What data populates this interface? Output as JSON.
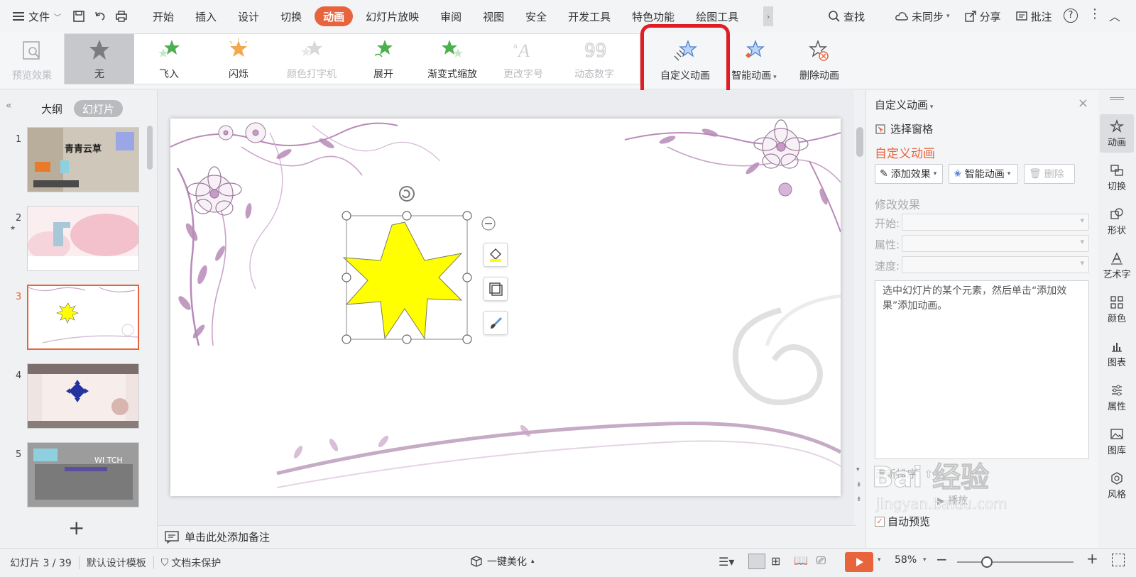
{
  "menubar": {
    "file_label": "文件",
    "tabs": [
      "开始",
      "插入",
      "设计",
      "切换",
      "动画",
      "幻灯片放映",
      "审阅",
      "视图",
      "安全",
      "开发工具",
      "特色功能",
      "绘图工具"
    ],
    "active_tab": "动画",
    "search_label": "查找",
    "sync_label": "未同步",
    "share_label": "分享",
    "comment_label": "批注"
  },
  "ribbon": {
    "preview_label": "预览效果",
    "gallery": [
      {
        "label": "无",
        "icon": "star-gray-icon",
        "selected": true,
        "disabled": false
      },
      {
        "label": "飞入",
        "icon": "star-fly-icon",
        "selected": false,
        "disabled": false
      },
      {
        "label": "闪烁",
        "icon": "star-flash-icon",
        "selected": false,
        "disabled": false
      },
      {
        "label": "颜色打字机",
        "icon": "star-typewriter-icon",
        "selected": false,
        "disabled": true
      },
      {
        "label": "展开",
        "icon": "star-expand-icon",
        "selected": false,
        "disabled": false
      },
      {
        "label": "渐变式缩放",
        "icon": "star-zoom-icon",
        "selected": false,
        "disabled": false
      },
      {
        "label": "更改字号",
        "icon": "font-size-icon",
        "selected": false,
        "disabled": true
      },
      {
        "label": "动态数字",
        "icon": "dynamic-number-icon",
        "selected": false,
        "disabled": true
      }
    ],
    "custom_animation_label": "自定义动画",
    "smart_animation_label": "智能动画",
    "delete_animation_label": "删除动画"
  },
  "left_panel": {
    "outline_tab": "大纲",
    "slides_tab": "幻灯片",
    "slides": [
      {
        "num": "1",
        "text": "青青云草"
      },
      {
        "num": "2",
        "text": ""
      },
      {
        "num": "3",
        "text": ""
      },
      {
        "num": "4",
        "text": ""
      },
      {
        "num": "5",
        "text": "WI TCH"
      }
    ],
    "active_slide": "3"
  },
  "notes": {
    "placeholder": "单击此处添加备注"
  },
  "task_pane": {
    "title": "自定义动画",
    "select_pane": "选择窗格",
    "heading": "自定义动画",
    "add_effect": "添加效果",
    "smart_animation": "智能动画",
    "delete": "删除",
    "modify_effect": "修改效果",
    "start_label": "开始:",
    "property_label": "属性:",
    "speed_label": "速度:",
    "hint": "选中幻灯片的某个元素，然后单击“添加效果”添加动画。",
    "reorder": "重新排序",
    "play": "播放",
    "auto_preview": "自动预览"
  },
  "sidebar": [
    "动画",
    "切换",
    "形状",
    "艺术字",
    "颜色",
    "图表",
    "属性",
    "图库",
    "风格"
  ],
  "statusbar": {
    "slide_info": "幻灯片 3 / 39",
    "template": "默认设计模板",
    "protection": "文档未保护",
    "beautify": "一键美化",
    "zoom": "58%"
  },
  "watermark": {
    "main": "Bai 经验",
    "sub": "jingyan.baidu.com"
  },
  "colors": {
    "accent": "#e8643c",
    "highlight": "#e01d25",
    "star_fill": "#ffff00",
    "floral": "#b88ab8"
  }
}
